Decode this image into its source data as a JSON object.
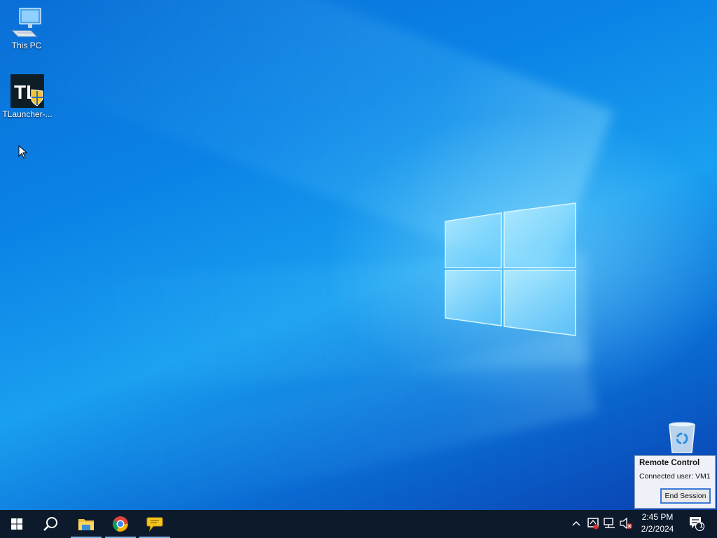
{
  "desktop": {
    "icons": [
      {
        "label": "This PC",
        "icon": "computer-icon"
      },
      {
        "label": "TLauncher-...",
        "icon": "tlauncher-icon",
        "badge_text": "TL"
      },
      {
        "label": "",
        "icon": "recycle-bin-icon"
      }
    ]
  },
  "remote_control": {
    "title": "Remote Control",
    "connected_user": "Connected user: VM1",
    "end_session_label": "End Session"
  },
  "taskbar": {
    "pinned": [
      {
        "name": "start",
        "icon": "windows-start-icon"
      },
      {
        "name": "search",
        "icon": "search-icon"
      },
      {
        "name": "file-explorer",
        "icon": "folder-icon"
      },
      {
        "name": "chrome",
        "icon": "chrome-icon"
      },
      {
        "name": "remote-chat",
        "icon": "speech-bubble-icon"
      }
    ],
    "tray": {
      "icons": [
        "chevron-up-icon",
        "remote-status-icon",
        "network-icon",
        "volume-muted-icon"
      ],
      "time": "2:45 PM",
      "date": "2/2/2024",
      "notification_count": "1"
    }
  },
  "colors": {
    "taskbar_bg": "#0c1a2b",
    "desktop_blue": "#0a82e6",
    "accent": "#3c78d8"
  }
}
